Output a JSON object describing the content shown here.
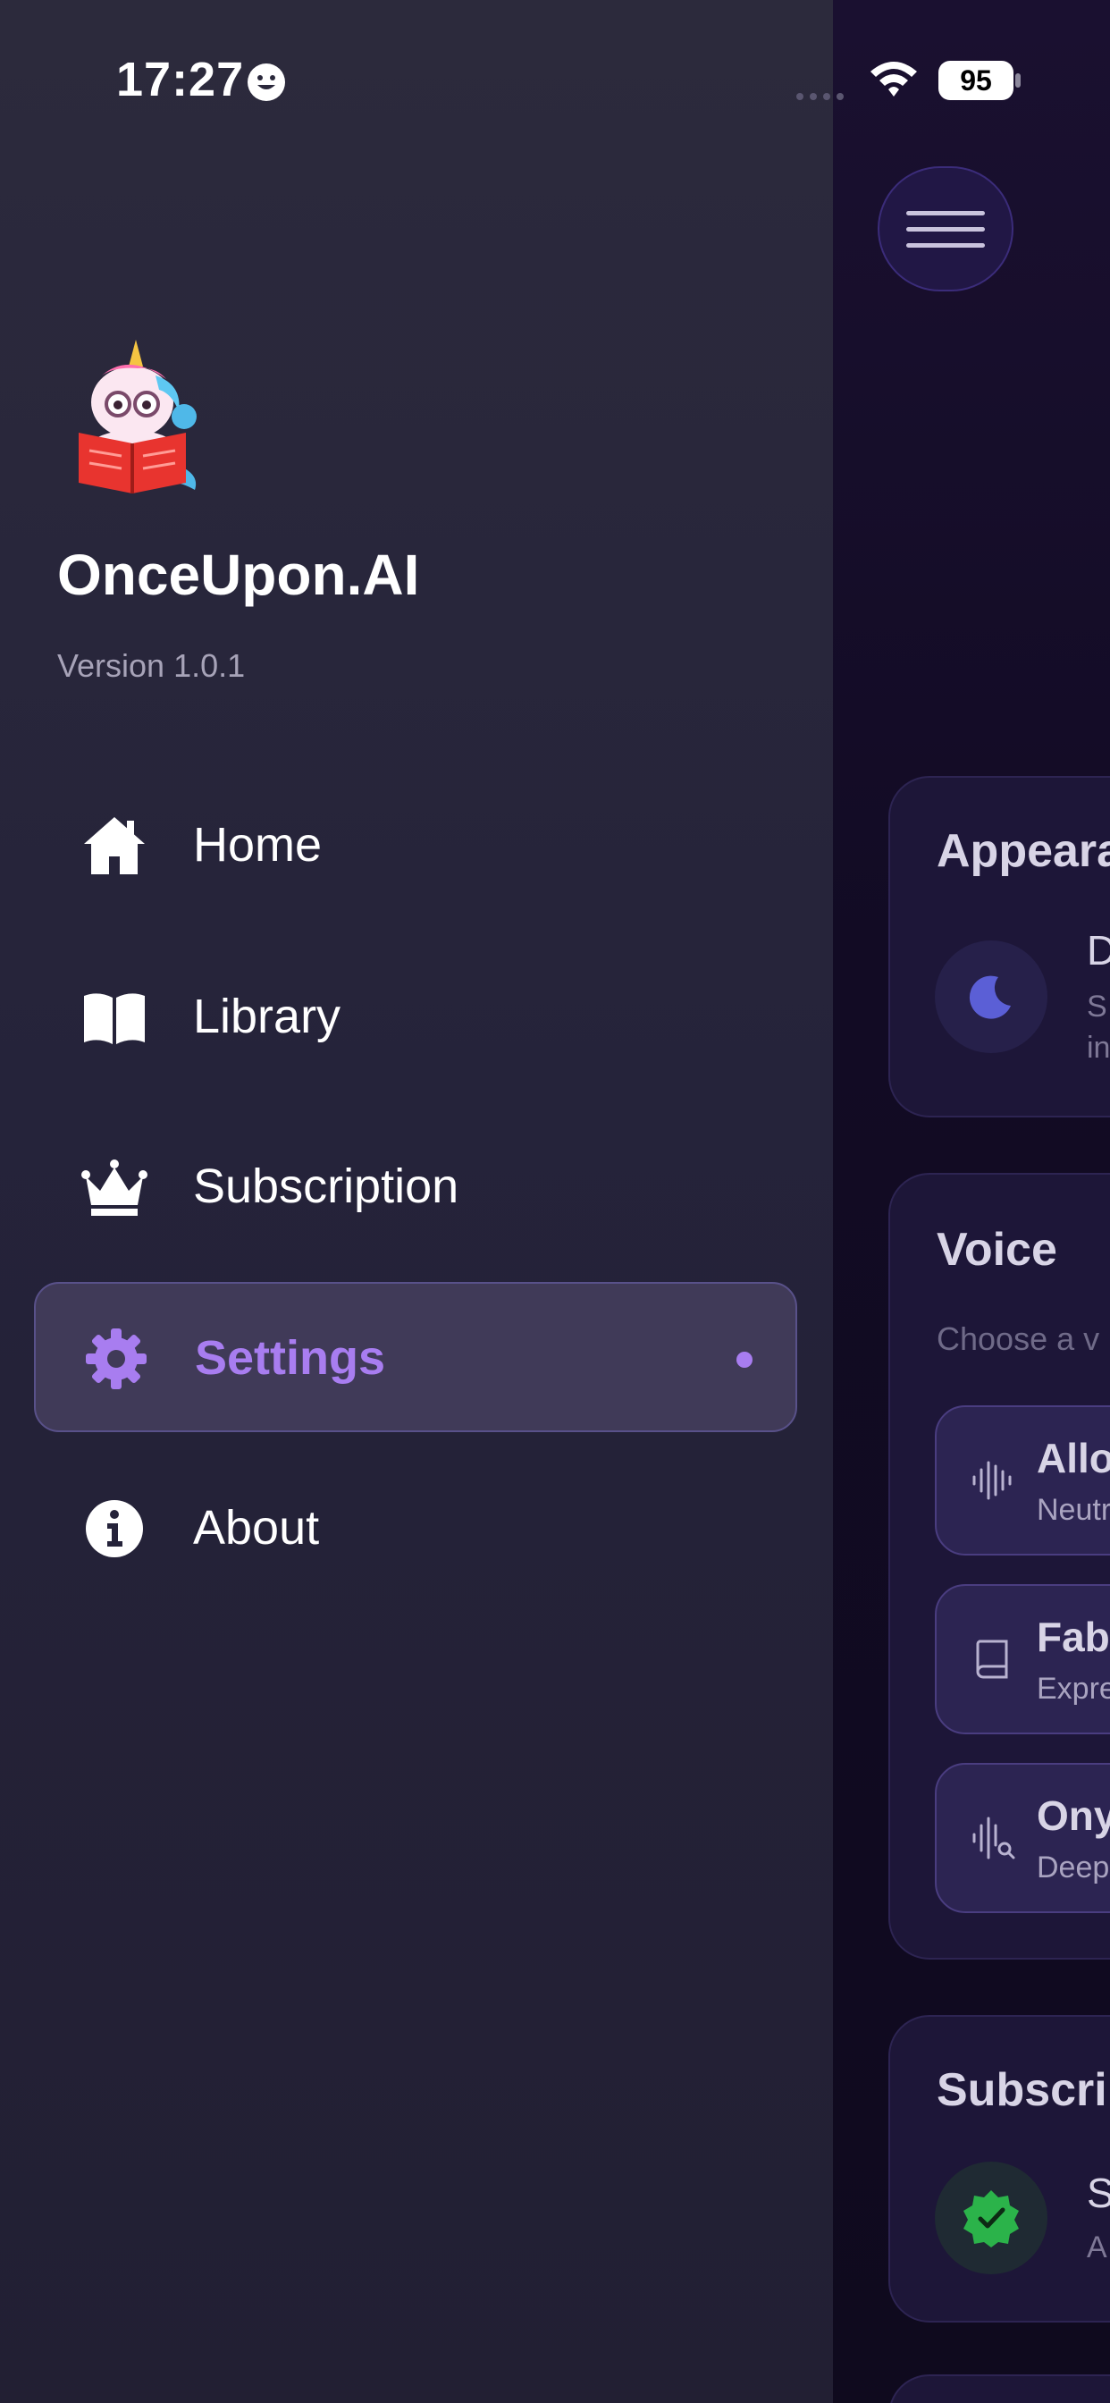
{
  "status_bar": {
    "time": "17:27",
    "battery": "95"
  },
  "app": {
    "name": "OnceUpon.AI",
    "version": "Version 1.0.1"
  },
  "nav": [
    {
      "label": "Home",
      "icon": "home-icon"
    },
    {
      "label": "Library",
      "icon": "book-icon"
    },
    {
      "label": "Subscription",
      "icon": "crown-icon"
    },
    {
      "label": "Settings",
      "icon": "gear-icon",
      "active": true
    },
    {
      "label": "About",
      "icon": "info-icon"
    }
  ],
  "settings_preview": {
    "appearance": {
      "title": "Appeara",
      "item_title": "D",
      "item_sub": [
        "S",
        "in"
      ]
    },
    "voice": {
      "title": "Voice",
      "hint": "Choose a v",
      "options": [
        {
          "name": "Allo",
          "desc": "Neutr"
        },
        {
          "name": "Fabl",
          "desc": "Expre"
        },
        {
          "name": "Ony",
          "desc": "Deep"
        }
      ]
    },
    "subscription": {
      "title": "Subscrip",
      "item_title": "S",
      "item_sub": "A"
    }
  },
  "colors": {
    "accent": "#a87df0",
    "drawer_bg": "#2a283b",
    "main_bg": "#0f0a1e"
  }
}
